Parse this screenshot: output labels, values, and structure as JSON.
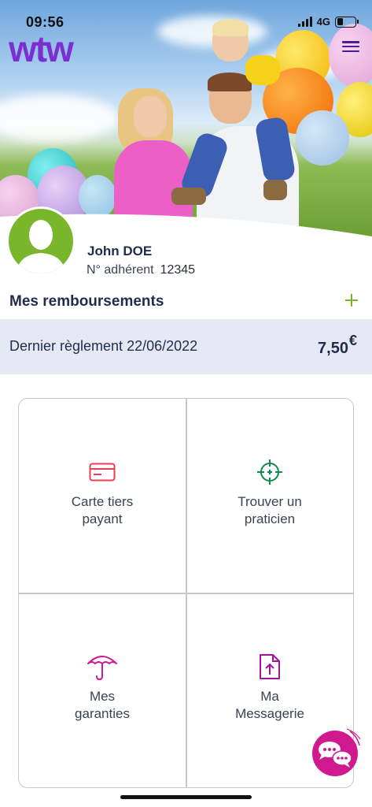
{
  "status_bar": {
    "time": "09:56",
    "network": "4G",
    "battery_level": 0.35
  },
  "header": {
    "logo_text": "wtw",
    "logo_color": "#7b2fd0",
    "menu_icon": "hamburger-menu-icon"
  },
  "profile": {
    "name": "John DOE",
    "member_label": "N° adhérent",
    "member_number": "12345",
    "avatar_icon": "user-silhouette-icon",
    "avatar_color": "#7ab62b"
  },
  "reimbursements": {
    "title": "Mes remboursements",
    "expand_icon": "plus-icon",
    "last_payment_label": "Dernier règlement 22/06/2022",
    "last_payment_amount": "7,50",
    "currency": "€"
  },
  "tiles": [
    {
      "label": "Carte tiers\npayant",
      "icon": "card-icon",
      "color": "#e8404e"
    },
    {
      "label": "Trouver un\npraticien",
      "icon": "crosshair-icon",
      "color": "#0e8a4a"
    },
    {
      "label": "Mes\ngaranties",
      "icon": "umbrella-icon",
      "color": "#d0188f"
    },
    {
      "label": "Ma\nMessagerie",
      "icon": "upload-document-icon",
      "color": "#a4149a"
    }
  ],
  "chat": {
    "icon": "chat-bubbles-icon",
    "color": "#d0188f"
  }
}
